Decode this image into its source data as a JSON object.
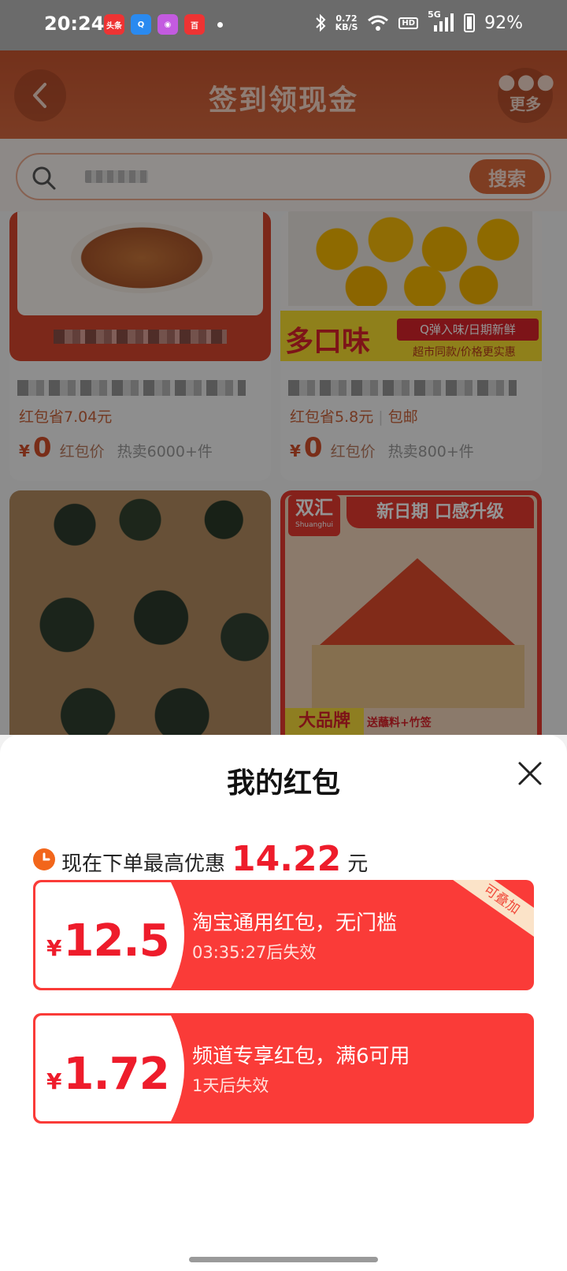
{
  "status_bar": {
    "time": "20:24",
    "apps": [
      "头条",
      "Q",
      "◉",
      "百"
    ],
    "net_speed_value": "0.72",
    "net_speed_unit": "KB/S",
    "hd": "HD",
    "network": "5G",
    "battery": "92%"
  },
  "header": {
    "title": "签到领现金",
    "more_label": "更多"
  },
  "search": {
    "button_label": "搜索"
  },
  "products": [
    {
      "saving": "红包省7.04元",
      "yen": "¥",
      "price": "0",
      "price_label": "红包价",
      "sold": "热卖6000+件"
    },
    {
      "saving": "红包省5.8元",
      "shipping": "包邮",
      "yen": "¥",
      "price": "0",
      "price_label": "红包价",
      "sold": "热卖800+件",
      "banner_big": "多口味",
      "banner_tag": "Q弹入味/日期新鲜",
      "banner_sub": "超市同款/价格更实惠"
    },
    {},
    {
      "brand": "双汇",
      "brand_en": "Shuanghui",
      "banner": "新日期 口感升级",
      "bottom_tag": "大品牌",
      "bottom_sub": "送蘸料+竹签"
    }
  ],
  "sheet": {
    "title": "我的红包",
    "summary_prefix": "现在下单最高优惠",
    "summary_amount": "14.22",
    "summary_unit": "元",
    "coupons": [
      {
        "symbol": "¥",
        "amount": "12.5",
        "name": "淘宝通用红包，无门槛",
        "expiry": "03:35:27后失效",
        "badge": "可叠加"
      },
      {
        "symbol": "¥",
        "amount": "1.72",
        "name": "频道专享红包，满6可用",
        "expiry": "1天后失效"
      }
    ]
  },
  "colors": {
    "accent_red": "#ee1c2b",
    "coupon_red": "#fa3b38",
    "header_orange": "#c7552f"
  }
}
